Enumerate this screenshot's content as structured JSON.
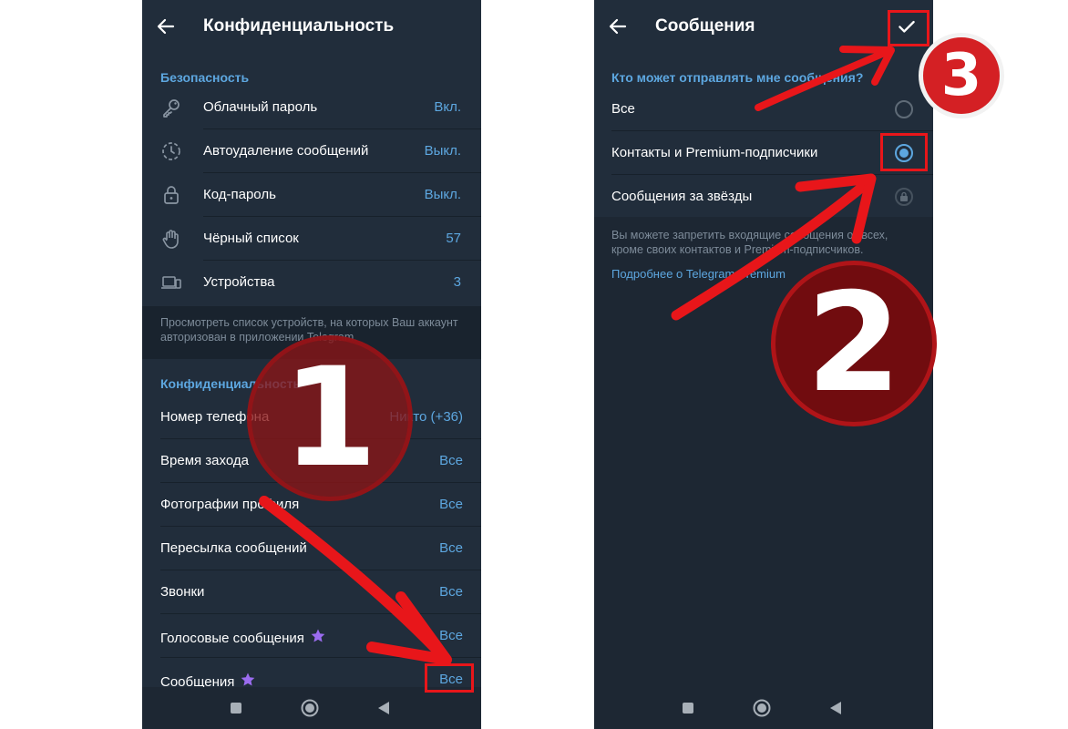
{
  "left_screen": {
    "title": "Конфиденциальность",
    "security": {
      "header": "Безопасность",
      "items": [
        {
          "label": "Облачный пароль",
          "value": "Вкл.",
          "icon": "key-icon"
        },
        {
          "label": "Автоудаление сообщений",
          "value": "Выкл.",
          "icon": "timer-icon"
        },
        {
          "label": "Код-пароль",
          "value": "Выкл.",
          "icon": "lock-icon"
        },
        {
          "label": "Чёрный список",
          "value": "57",
          "icon": "hand-icon"
        },
        {
          "label": "Устройства",
          "value": "3",
          "icon": "devices-icon"
        }
      ],
      "hint": "Просмотреть список устройств, на которых Ваш аккаунт авторизован в приложении Telegram."
    },
    "privacy": {
      "header": "Конфиденциальность",
      "items": [
        {
          "label": "Номер телефона",
          "value": "Никто (+36)"
        },
        {
          "label": "Время захода",
          "value": "Все"
        },
        {
          "label": "Фотографии профиля",
          "value": "Все"
        },
        {
          "label": "Пересылка сообщений",
          "value": "Все"
        },
        {
          "label": "Звонки",
          "value": "Все"
        },
        {
          "label": "Голосовые сообщения",
          "value": "Все",
          "premium": true
        },
        {
          "label": "Сообщения",
          "value": "Все",
          "premium": true
        }
      ]
    }
  },
  "right_screen": {
    "title": "Сообщения",
    "header": "Кто может отправлять мне сообщения?",
    "options": [
      {
        "label": "Все",
        "state": "unchecked"
      },
      {
        "label": "Контакты и Premium-подписчики",
        "state": "checked"
      },
      {
        "label": "Сообщения за звёзды",
        "state": "locked"
      }
    ],
    "hint": "Вы можете запретить входящие сообщения от всех, кроме своих контактов и Premium-подписчиков.",
    "link": "Подробнее о Telegram Premium"
  },
  "annotations": {
    "step1": "1",
    "step2": "2",
    "step3": "3",
    "color": "#e8161a"
  },
  "colors": {
    "background": "#1d2733",
    "accent": "#5da7e0",
    "premium_star": "#9b6cf0"
  }
}
